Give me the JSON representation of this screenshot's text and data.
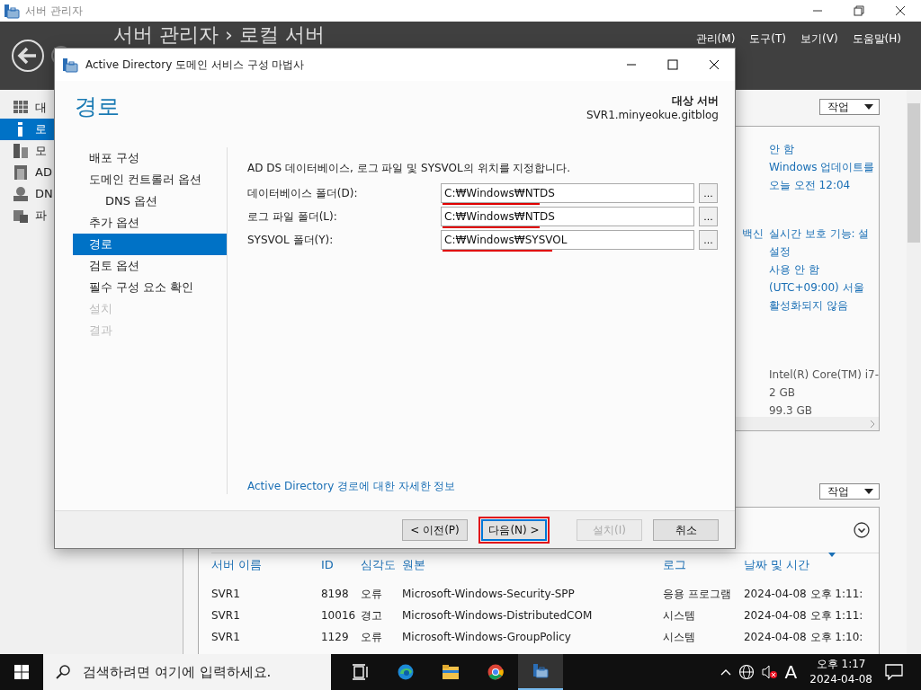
{
  "app": {
    "title": "서버 관리자",
    "header_title": "서버 관리자 › 로컬 서버",
    "menus": [
      "관리(M)",
      "도구(T)",
      "보기(V)",
      "도움말(H)"
    ]
  },
  "sidebar": {
    "items": [
      {
        "label": "대",
        "selected": false
      },
      {
        "label": "로",
        "selected": true
      },
      {
        "label": "모",
        "selected": false
      },
      {
        "label": "AD",
        "selected": false
      },
      {
        "label": "DN",
        "selected": false
      },
      {
        "label": "파",
        "selected": false
      }
    ]
  },
  "properties_section": {
    "tasks_button": "작업",
    "groups": [
      [
        {
          "value": "안 함"
        },
        {
          "value": "Windows 업데이트를"
        },
        {
          "value": "오늘 오전 12:04"
        }
      ],
      [
        {
          "label": "백신",
          "value": "실시간 보호 기능: 설"
        },
        {
          "value": "설정"
        },
        {
          "value": "사용 안 함"
        },
        {
          "value": "(UTC+09:00) 서울"
        },
        {
          "value": "활성화되지 않음"
        }
      ],
      [
        {
          "value": "Intel(R) Core(TM) i7-",
          "plain": true
        },
        {
          "value": "2 GB",
          "plain": true
        },
        {
          "value": "99.3 GB",
          "plain": true
        }
      ]
    ]
  },
  "events_section": {
    "tasks_button": "작업",
    "columns": [
      "서버 이름",
      "ID",
      "심각도",
      "원본",
      "로그",
      "날짜 및 시간"
    ],
    "rows": [
      [
        "SVR1",
        "8198",
        "오류",
        "Microsoft-Windows-Security-SPP",
        "응용 프로그램",
        "2024-04-08 오후 1:11:"
      ],
      [
        "SVR1",
        "10016",
        "경고",
        "Microsoft-Windows-DistributedCOM",
        "시스템",
        "2024-04-08 오후 1:11:"
      ],
      [
        "SVR1",
        "1129",
        "오류",
        "Microsoft-Windows-GroupPolicy",
        "시스템",
        "2024-04-08 오후 1:10:"
      ]
    ]
  },
  "dialog": {
    "title": "Active Directory 도메인 서비스 구성 마법사",
    "page_title": "경로",
    "target_label": "대상 서버",
    "target_server": "SVR1.minyeokue.gitblog",
    "nav": [
      {
        "label": "배포 구성",
        "selected": false,
        "disabled": false
      },
      {
        "label": "도메인 컨트롤러 옵션",
        "selected": false,
        "disabled": false,
        "children": [
          {
            "label": "DNS 옵션",
            "selected": false,
            "disabled": false
          }
        ]
      },
      {
        "label": "추가 옵션",
        "selected": false,
        "disabled": false
      },
      {
        "label": "경로",
        "selected": true,
        "disabled": false
      },
      {
        "label": "검토 옵션",
        "selected": false,
        "disabled": false
      },
      {
        "label": "필수 구성 요소 확인",
        "selected": false,
        "disabled": false
      },
      {
        "label": "설치",
        "selected": false,
        "disabled": true
      },
      {
        "label": "결과",
        "selected": false,
        "disabled": true
      }
    ],
    "description": "AD DS 데이터베이스, 로그 파일 및 SYSVOL의 위치를 지정합니다.",
    "fields": [
      {
        "label": "데이터베이스 폴더(D):",
        "value": "C:₩Windows₩NTDS",
        "annotated": true,
        "browse": "..."
      },
      {
        "label": "로그 파일 폴더(L):",
        "value": "C:₩Windows₩NTDS",
        "annotated": true,
        "browse": "..."
      },
      {
        "label": "SYSVOL 폴더(Y):",
        "value": "C:₩Windows₩SYSVOL",
        "annotated": true,
        "browse": "..."
      }
    ],
    "link": "Active Directory 경로에 대한 자세한 정보",
    "buttons": [
      {
        "label": "< 이전(P)",
        "disabled": false,
        "annotated": false,
        "default": false
      },
      {
        "label": "다음(N) >",
        "disabled": false,
        "annotated": true,
        "default": true
      },
      {
        "label": "설치(I)",
        "disabled": true,
        "annotated": false,
        "default": false
      },
      {
        "label": "취소",
        "disabled": false,
        "annotated": false,
        "default": false
      }
    ]
  },
  "taskbar": {
    "search_placeholder": "검색하려면 여기에 입력하세요.",
    "ime": "A",
    "time": "오후 1:17",
    "date": "2024-04-08"
  }
}
